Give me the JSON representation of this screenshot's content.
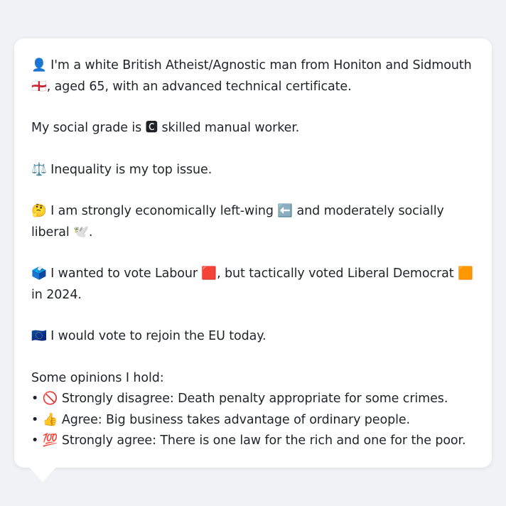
{
  "persona": {
    "intro": "👤 I'm a white British Atheist/Agnostic man from Honiton and Sidmouth 🏴󠁧󠁢󠁥󠁮󠁧󠁿, aged 65, with an advanced technical certificate.",
    "social_grade": "My social grade is 🅲 skilled manual worker.",
    "top_issue": "⚖️ Inequality is my top issue.",
    "ideology": "🤔 I am strongly economically left-wing ⬅️ and moderately socially liberal 🕊️.",
    "vote": "🗳️ I wanted to vote Labour 🟥, but tactically voted Liberal Democrat 🟧 in 2024.",
    "eu": "🇪🇺 I would vote to rejoin the EU today.",
    "opinions_heading": "Some opinions I hold:",
    "opinions": [
      "• 🚫 Strongly disagree: Death penalty appropriate for some crimes.",
      "• 👍 Agree: Big business takes advantage of ordinary people.",
      "• 💯 Strongly agree: There is one law for the rich and one for the poor."
    ]
  }
}
